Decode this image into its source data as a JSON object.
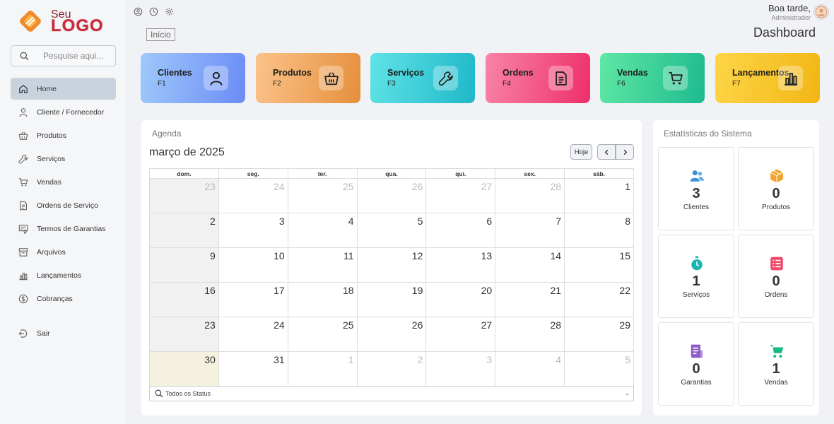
{
  "logo": {
    "small": "Seu",
    "big": "LOGO"
  },
  "search": {
    "placeholder": "Pesquise aqui..."
  },
  "sidebar": {
    "items": [
      {
        "label": "Home",
        "icon": "home-icon"
      },
      {
        "label": "Cliente / Fornecedor",
        "icon": "user-icon"
      },
      {
        "label": "Produtos",
        "icon": "basket-icon"
      },
      {
        "label": "Serviços",
        "icon": "wrench-icon"
      },
      {
        "label": "Vendas",
        "icon": "cart-icon"
      },
      {
        "label": "Ordens de Serviço",
        "icon": "document-icon"
      },
      {
        "label": "Termos de Garantias",
        "icon": "certificate-icon"
      },
      {
        "label": "Arquivos",
        "icon": "archive-icon"
      },
      {
        "label": "Lançamentos",
        "icon": "bar-chart-icon"
      },
      {
        "label": "Cobranças",
        "icon": "dollar-icon"
      }
    ],
    "exit": "Sair"
  },
  "header": {
    "greeting": "Boa tarde,",
    "role": "Administrador",
    "breadcrumb": "Início",
    "title": "Dashboard"
  },
  "cards": [
    {
      "title": "Clientes",
      "key": "F1",
      "icon": "user-icon"
    },
    {
      "title": "Produtos",
      "key": "F2",
      "icon": "basket-icon"
    },
    {
      "title": "Serviços",
      "key": "F3",
      "icon": "wrench-icon"
    },
    {
      "title": "Ordens",
      "key": "F4",
      "icon": "document-icon"
    },
    {
      "title": "Vendas",
      "key": "F6",
      "icon": "cart-icon"
    },
    {
      "title": "Lançamentos",
      "key": "F7",
      "icon": "bar-chart-icon"
    }
  ],
  "agenda": {
    "title": "Agenda",
    "month": "março de 2025",
    "today_button": "Hoje",
    "weekdays": [
      "dom.",
      "seg.",
      "ter.",
      "qua.",
      "qui.",
      "sex.",
      "sáb."
    ],
    "weeks": [
      [
        "23",
        "24",
        "25",
        "26",
        "27",
        "28",
        "1"
      ],
      [
        "2",
        "3",
        "4",
        "5",
        "6",
        "7",
        "8"
      ],
      [
        "9",
        "10",
        "11",
        "12",
        "13",
        "14",
        "15"
      ],
      [
        "16",
        "17",
        "18",
        "19",
        "20",
        "21",
        "22"
      ],
      [
        "23",
        "24",
        "25",
        "26",
        "27",
        "28",
        "29"
      ],
      [
        "30",
        "31",
        "1",
        "2",
        "3",
        "4",
        "5"
      ]
    ],
    "status_filter": "Todos os Status"
  },
  "stats": {
    "title": "Estatísticas do Sistema",
    "tiles": [
      {
        "value": "3",
        "label": "Clientes",
        "icon": "users-icon",
        "color": "#3a8fd8"
      },
      {
        "value": "0",
        "label": "Produtos",
        "icon": "box-icon",
        "color": "#f2a12a"
      },
      {
        "value": "1",
        "label": "Serviços",
        "icon": "stopwatch-icon",
        "color": "#19b5b0"
      },
      {
        "value": "0",
        "label": "Ordens",
        "icon": "list-icon",
        "color": "#ee4b6a"
      },
      {
        "value": "0",
        "label": "Garantias",
        "icon": "invoice-icon",
        "color": "#8b5cc4"
      },
      {
        "value": "1",
        "label": "Vendas",
        "icon": "cart-icon",
        "color": "#15b87d"
      }
    ]
  },
  "colors": {
    "card_clientes": "#6a8cf6",
    "card_produtos": "#e68f3c",
    "card_servicos": "#1fb8c9",
    "card_ordens": "#ee2f6a",
    "card_vendas": "#1dbb8f",
    "card_lancamentos": "#f2b614"
  }
}
